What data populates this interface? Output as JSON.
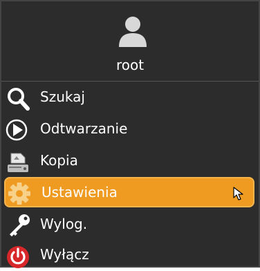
{
  "header": {
    "avatar_icon": "user-icon",
    "username": "root"
  },
  "menu": {
    "items": [
      {
        "label": "Szukaj",
        "icon": "search-icon",
        "selected": false
      },
      {
        "label": "Odtwarzanie",
        "icon": "play-icon",
        "selected": false
      },
      {
        "label": "Kopia",
        "icon": "backup-drive-icon",
        "selected": false
      },
      {
        "label": "Ustawienia",
        "icon": "gear-icon",
        "selected": true
      },
      {
        "label": "Wylog.",
        "icon": "key-icon",
        "selected": false
      },
      {
        "label": "Wyłącz",
        "icon": "power-icon",
        "selected": false
      }
    ]
  },
  "colors": {
    "panel_bg": "#2c2c2c",
    "selected_bg": "#ef9b22",
    "power_red": "#d8272a"
  }
}
